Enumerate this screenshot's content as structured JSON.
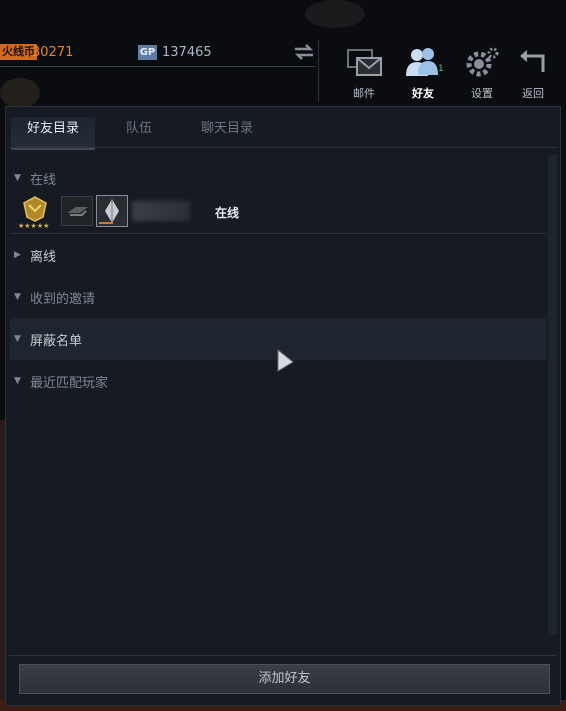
{
  "currency": {
    "cf_label": "火线币",
    "cf_value": "30271",
    "gp_label": "GP",
    "gp_value": "137465"
  },
  "nav": {
    "mail": "邮件",
    "friends": "好友",
    "friends_badge": "1",
    "settings": "设置",
    "back": "返回"
  },
  "tabs": [
    "好友目录",
    "队伍",
    "聊天目录"
  ],
  "sections": {
    "online": "在线",
    "offline": "离线",
    "invites": "收到的邀请",
    "blocked": "屏蔽名单",
    "recent": "最近匹配玩家"
  },
  "friend": {
    "status": "在线",
    "icons": [
      "rank-icon",
      "clan-icon",
      "title-icon"
    ]
  },
  "footer": {
    "add_friend": "添加好友"
  },
  "colors": {
    "panel_bg": "#161b23",
    "accent_orange": "#d06a1e",
    "gp_blue": "#5f7da3",
    "friends_icon": "#9cc3e6"
  }
}
